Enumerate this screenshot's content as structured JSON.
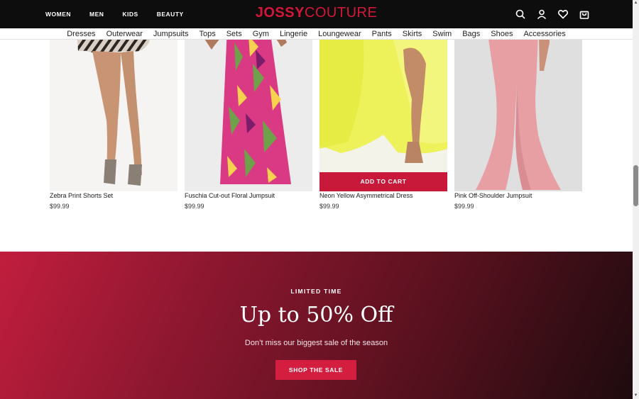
{
  "header": {
    "nav": [
      "WOMEN",
      "MEN",
      "KIDS",
      "BEAUTY"
    ],
    "logo_part1": "JOSSY",
    "logo_part2": "COUTURE",
    "icons": [
      "search-icon",
      "user-icon",
      "heart-icon",
      "bag-icon"
    ]
  },
  "categories": [
    "Dresses",
    "Outerwear",
    "Jumpsuits",
    "Tops",
    "Sets",
    "Gym",
    "Lingerie",
    "Loungewear",
    "Pants",
    "Skirts",
    "Swim",
    "Bags",
    "Shoes",
    "Accessories"
  ],
  "products": [
    {
      "name": "Zebra Print Shorts Set",
      "price": "$99.99"
    },
    {
      "name": "Fuschia Cut-out Floral Jumpsuit",
      "price": "$99.99"
    },
    {
      "name": "Neon Yellow Asymmetrical Dress",
      "price": "$99.99"
    },
    {
      "name": "Pink Off-Shoulder Jumpsuit",
      "price": "$99.99"
    }
  ],
  "add_to_cart_label": "ADD TO CART",
  "promo": {
    "kicker": "LIMITED TIME",
    "headline": "Up to 50% Off",
    "subtext": "Don’t miss our biggest sale of the season",
    "button": "SHOP THE SALE"
  },
  "colors": {
    "header_bg": "#0d0d0d",
    "brand_red": "#d3173a",
    "button_red": "#c8193b"
  }
}
